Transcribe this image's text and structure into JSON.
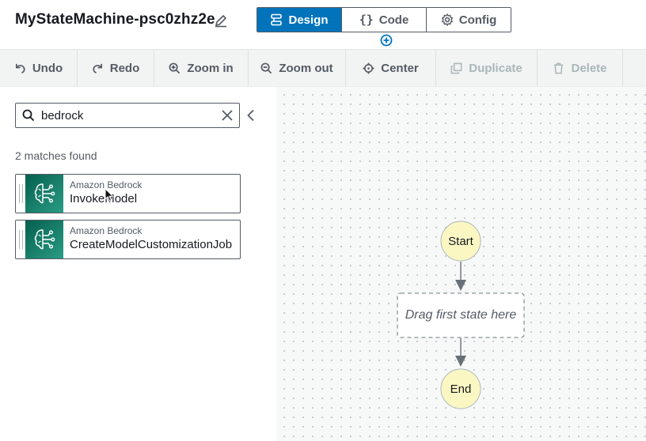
{
  "header": {
    "title": "MyStateMachine-psc0zhz2e",
    "tabs": [
      {
        "label": "Design",
        "icon": "design-icon",
        "active": true
      },
      {
        "label": "Code",
        "icon": "code-braces-icon",
        "active": false
      },
      {
        "label": "Config",
        "icon": "gear-icon",
        "active": false
      }
    ]
  },
  "toolbar": {
    "undo": "Undo",
    "redo": "Redo",
    "zoom_in": "Zoom in",
    "zoom_out": "Zoom out",
    "center": "Center",
    "duplicate": "Duplicate",
    "delete": "Delete"
  },
  "search": {
    "value": "bedrock",
    "matches_text": "2 matches found"
  },
  "results": [
    {
      "service": "Amazon Bedrock",
      "action": "InvokeModel"
    },
    {
      "service": "Amazon Bedrock",
      "action": "CreateModelCustomizationJob"
    }
  ],
  "canvas": {
    "start_label": "Start",
    "drop_label": "Drag first state here",
    "end_label": "End"
  },
  "colors": {
    "accent": "#0073bb",
    "node_fill": "#fbf7c3",
    "bedrock_green": "#1e8a73"
  }
}
